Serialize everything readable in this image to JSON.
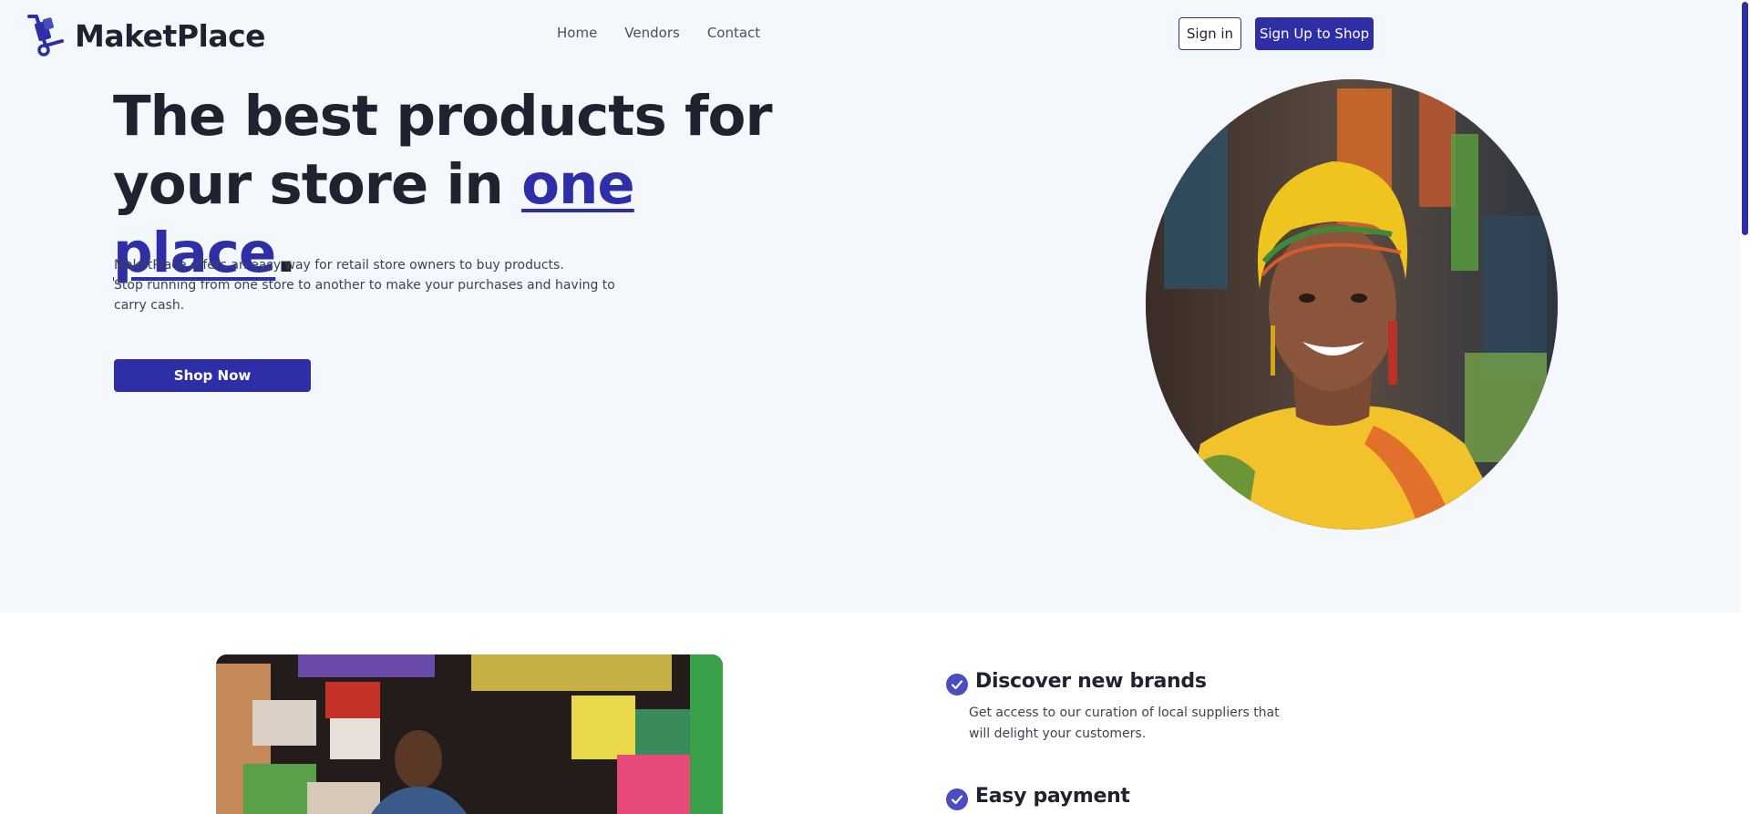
{
  "header": {
    "logo_text": "MaketPlace",
    "nav": [
      {
        "label": "Home"
      },
      {
        "label": "Vendors"
      },
      {
        "label": "Contact"
      }
    ],
    "signin_label": "Sign in",
    "signup_label": "Sign Up to Shop"
  },
  "hero": {
    "headline_part1": "The best products for your store in ",
    "headline_accent": "one place",
    "headline_end": ".",
    "description_lines": [
      "MaketPlace offers an easy way for retail store owners to buy products.",
      "Stop running from one store to another to make your purchases and having to carry cash."
    ],
    "cta_label": "Shop Now"
  },
  "features": [
    {
      "title": "Discover new brands",
      "description": "Get access to our curation of local suppliers that will delight your customers."
    },
    {
      "title": "Easy payment",
      "description": ""
    }
  ],
  "colors": {
    "accent": "#2e2fa6",
    "hero_background": "#f4f8fd",
    "text": "#1f2330",
    "check_badge": "#4a4cc0"
  },
  "icons": {
    "logo": "hand-truck-icon",
    "feature_check": "check-circle-icon"
  }
}
